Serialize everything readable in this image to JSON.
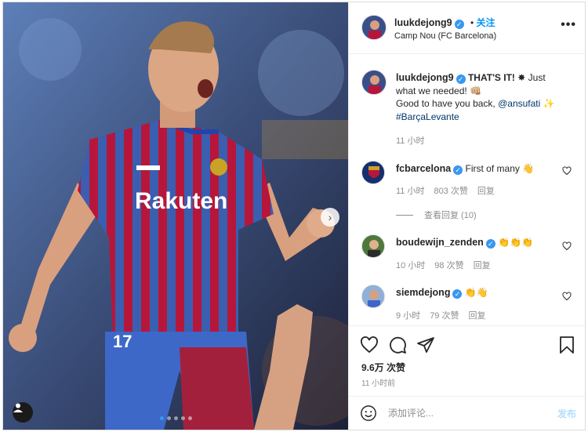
{
  "post": {
    "author": "luukdejong9",
    "follow_dot": "•",
    "follow_label": "关注",
    "location": "Camp Nou (FC Barcelona)",
    "more_label": "•••"
  },
  "caption": {
    "author": "luukdejong9",
    "line1_bold": "THAT'S IT!",
    "line1_rest": "Just",
    "line2": "what we needed! 👊🏼",
    "line3_pre": "Good to have you back, ",
    "mention": "@ansufati",
    "line3_post": " ✨",
    "hashtag": "#BarçaLevante",
    "time": "11 小时"
  },
  "comments": [
    {
      "username": "fcbarcelona",
      "text": "First of many 👋",
      "time": "11 小时",
      "likes": "803 次赞",
      "reply_label": "回复",
      "view_replies": "查看回复 (10)"
    },
    {
      "username": "boudewijn_zenden",
      "text": "👏👏👏",
      "time": "10 小时",
      "likes": "98 次赞",
      "reply_label": "回复"
    },
    {
      "username": "siemdejong",
      "text": "👏👋",
      "time": "9 小时",
      "likes": "79 次赞",
      "reply_label": "回复"
    }
  ],
  "footer": {
    "likes": "9.6万 次赞",
    "time_ago": "11 小时前",
    "comment_placeholder": "添加评论...",
    "post_label": "发布"
  },
  "photo": {
    "shirt_text": "Rakuten",
    "shirt_number": "17"
  },
  "carousel": {
    "slides": 5,
    "active": 0
  },
  "colors": {
    "accent": "#0095f6",
    "verified": "#3897f0",
    "muted": "#8e8e8e",
    "barca_blue": "#3563b5",
    "barca_red": "#b7163b"
  }
}
